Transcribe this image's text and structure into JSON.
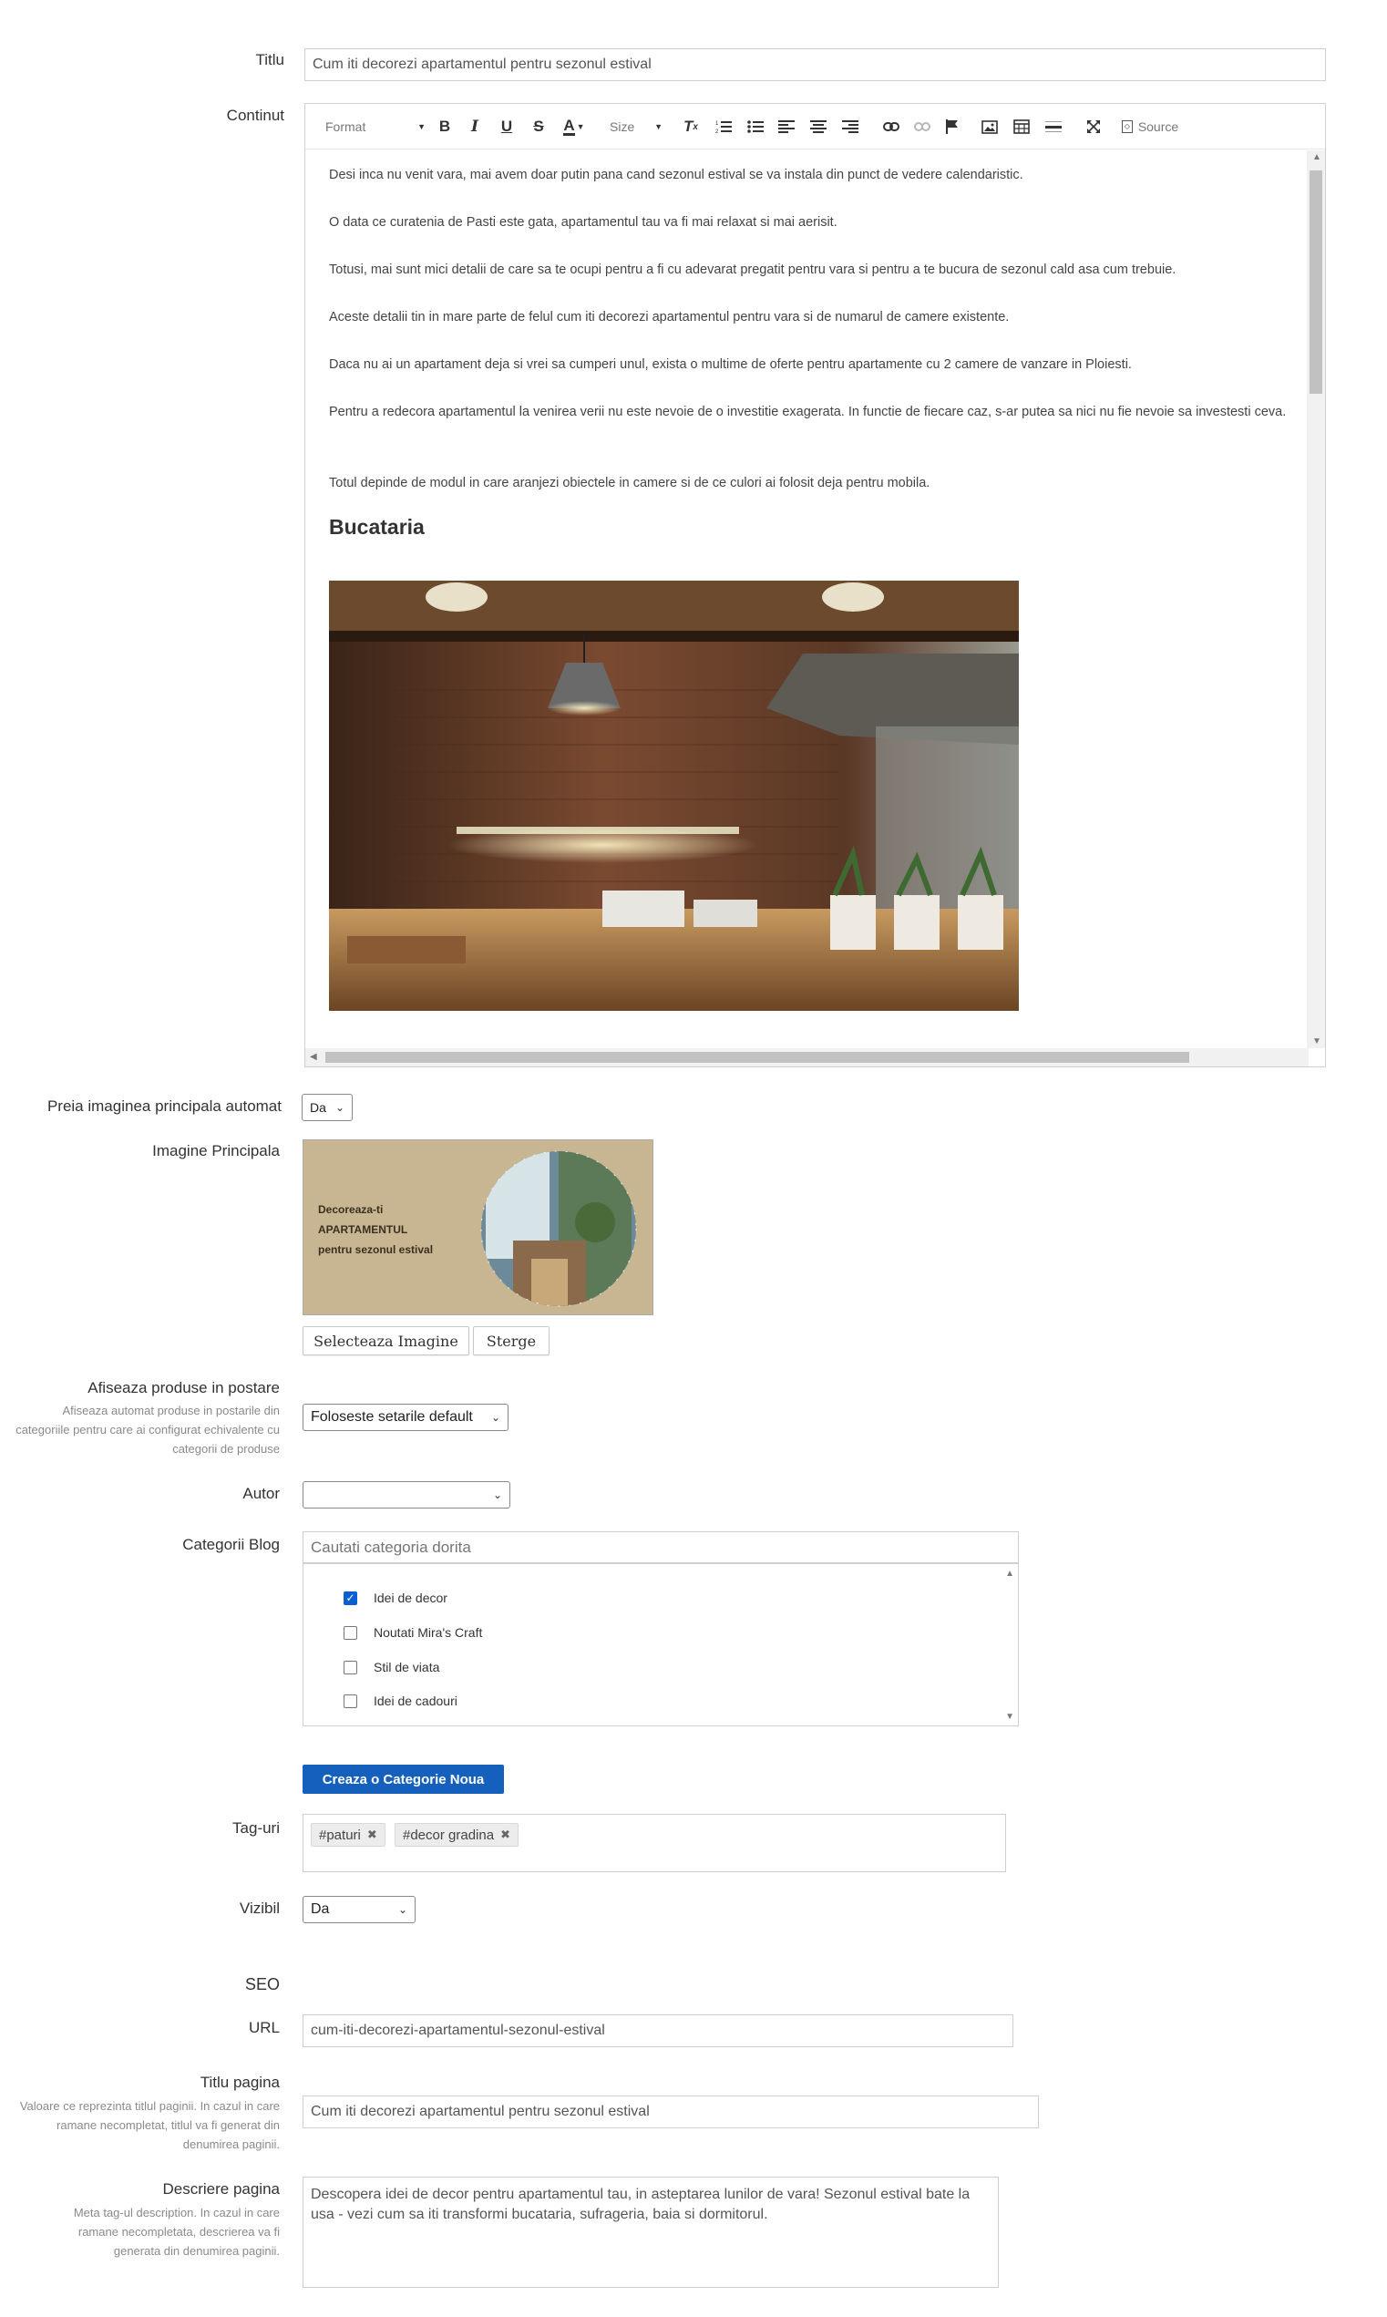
{
  "form": {
    "title_label": "Titlu",
    "title_value": "Cum iti decorezi apartamentul pentru sezonul estival",
    "content_label": "Continut",
    "auto_image_label": "Preia imaginea principala automat",
    "auto_image_value": "Da",
    "main_image_label": "Imagine Principala",
    "main_image_text": [
      "Decoreaza-ti",
      "APARTAMENTUL",
      "pentru sezonul estival"
    ],
    "select_image_button": "Selecteaza Imagine",
    "delete_button": "Sterge",
    "show_products_label": "Afiseaza produse in postare",
    "show_products_hint": "Afiseaza automat produse in postarile din categoriile pentru care ai configurat echivalente cu categorii de produse",
    "show_products_value": "Foloseste setarile default",
    "author_label": "Autor",
    "author_value": "",
    "categories_label": "Categorii Blog",
    "categories_search_placeholder": "Cautati categoria dorita",
    "categories": [
      {
        "label": "Idei de decor",
        "checked": true
      },
      {
        "label": "Noutati Mira's Craft",
        "checked": false
      },
      {
        "label": "Stil de viata",
        "checked": false
      },
      {
        "label": "Idei de cadouri",
        "checked": false
      }
    ],
    "new_category_button": "Creaza o Categorie Noua",
    "tags_label": "Tag-uri",
    "tags": [
      "#paturi",
      "#decor gradina"
    ],
    "visible_label": "Vizibil",
    "visible_value": "Da",
    "seo_heading": "SEO",
    "url_label": "URL",
    "url_value": "cum-iti-decorezi-apartamentul-sezonul-estival",
    "page_title_label": "Titlu pagina",
    "page_title_hint": "Valoare ce reprezinta titlul paginii. In cazul in care ramane necompletat, titlul va fi generat din denumirea paginii.",
    "page_title_value": "Cum iti decorezi apartamentul pentru sezonul estival",
    "page_desc_label": "Descriere pagina",
    "page_desc_hint": "Meta tag-ul description. In cazul in care ramane necompletata, descrierea va fi generata din denumirea paginii.",
    "page_desc_value": "Descopera idei de decor pentru apartamentul tau, in asteptarea lunilor de vara! Sezonul estival bate la usa - vezi cum sa iti transformi bucataria, sufrageria, baia si dormitorul."
  },
  "editor": {
    "format_label": "Format",
    "size_label": "Size",
    "source_label": "Source",
    "paragraphs": [
      "Desi inca nu venit vara, mai avem doar putin pana cand sezonul estival se va instala din punct de vedere calendaristic.",
      "O data ce curatenia de Pasti este gata, apartamentul tau va fi mai relaxat si mai aerisit.",
      "Totusi, mai sunt mici detalii de care sa te ocupi pentru a fi cu adevarat pregatit pentru vara si pentru a te bucura de sezonul cald asa cum trebuie.",
      "Aceste detalii tin in mare parte de felul cum iti decorezi apartamentul pentru vara si de numarul de camere existente.",
      "Daca nu ai un apartament deja si vrei sa cumperi unul, exista o multime de oferte pentru apartamente cu 2 camere de vanzare in Ploiesti.",
      "Pentru a redecora apartamentul la venirea verii nu este nevoie de o investitie exagerata. In functie de fiecare caz, s-ar putea sa nici nu fie nevoie sa investesti ceva.",
      "Totul depinde de modul in care aranjezi obiectele in camere si de ce culori ai folosit deja pentru mobila."
    ],
    "heading": "Bucataria"
  },
  "colors": {
    "primary_button": "#1560bd",
    "checkbox": "#0a5fd1"
  }
}
